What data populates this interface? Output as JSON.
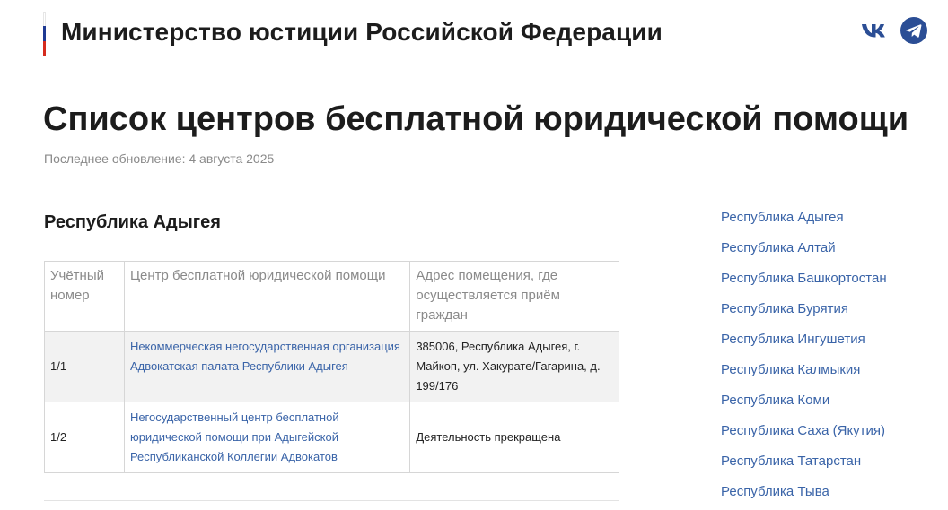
{
  "header": {
    "site_title": "Министерство юстиции Российской Федерации",
    "social": [
      {
        "name": "vk-icon",
        "color": "#2b4e95"
      },
      {
        "name": "telegram-icon",
        "color": "#2b4e95"
      }
    ]
  },
  "page": {
    "title": "Список центров бесплатной юридической помощи",
    "updated": "Последнее обновление: 4 августа 2025"
  },
  "section": {
    "title": "Республика Адыгея",
    "table": {
      "headers": [
        "Учётный номер",
        "Центр бесплатной юридической помощи",
        "Адрес помещения, где осуществляется приём граждан"
      ],
      "rows": [
        {
          "number": "1/1",
          "center": "Некоммерческая негосударственная организация Адвокатская палата Республики Адыгея",
          "address": "385006, Республика Адыгея, г. Майкоп, ул. Хакурате/Гагарина, д. 199/176"
        },
        {
          "number": "1/2",
          "center": "Негосударственный центр бесплатной юридической помощи при Адыгейской Республиканской Коллегии Адвокатов",
          "address": "Деятельность прекращена"
        }
      ]
    }
  },
  "sidebar": {
    "items": [
      {
        "label": "Республика Адыгея"
      },
      {
        "label": "Республика Алтай"
      },
      {
        "label": "Республика Башкортостан"
      },
      {
        "label": "Республика Бурятия"
      },
      {
        "label": "Республика Ингушетия"
      },
      {
        "label": "Республика Калмыкия"
      },
      {
        "label": "Республика Коми"
      },
      {
        "label": "Республика Саха (Якутия)"
      },
      {
        "label": "Республика Татарстан"
      },
      {
        "label": "Республика Тыва"
      }
    ]
  },
  "colors": {
    "link": "#3a64a8",
    "brand": "#2b4e95",
    "flag_blue": "#1f3a93",
    "flag_red": "#d52b1e"
  }
}
